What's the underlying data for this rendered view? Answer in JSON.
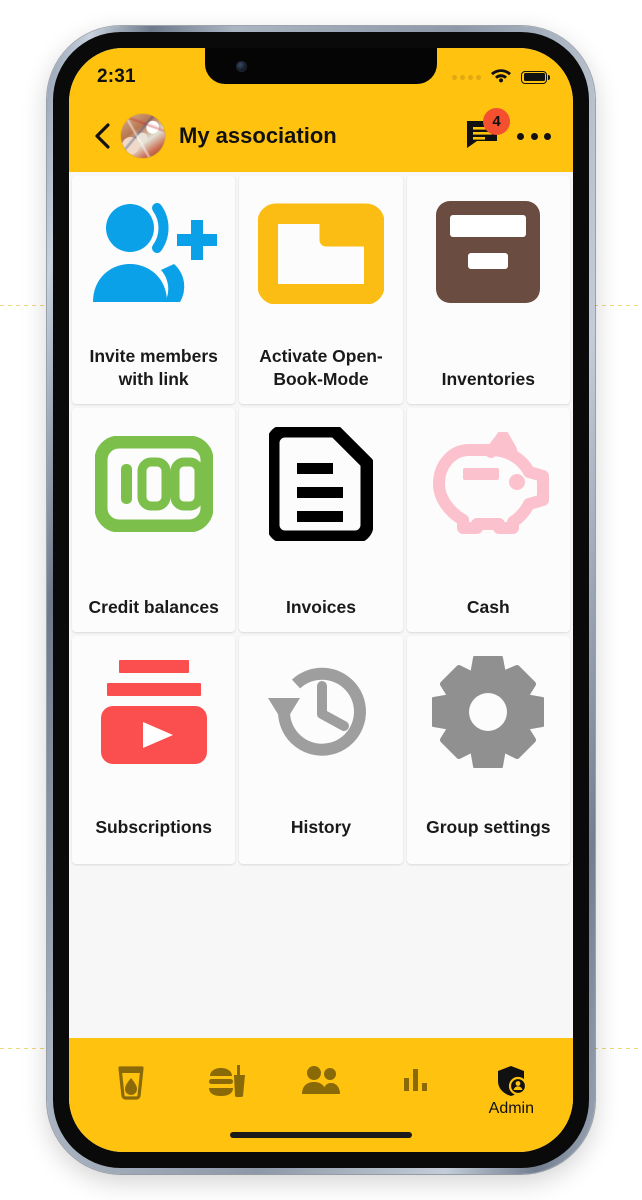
{
  "status_bar": {
    "time": "2:31",
    "cellular_icon": "signal-dots-icon",
    "wifi_icon": "wifi-icon",
    "battery_icon": "battery-full-icon"
  },
  "app_bar": {
    "back_icon": "back-chevron-icon",
    "avatar": "group-photo-avatar",
    "title": "My association",
    "chat_icon": "chat-bubble-icon",
    "chat_badge_count": "4",
    "overflow_icon": "more-options-icon"
  },
  "grid": {
    "tiles": [
      {
        "label": "Invite members with link",
        "icon": "person-add-icon",
        "color": "#0BA1E8"
      },
      {
        "label": "Activate Open-Book-Mode",
        "icon": "open-folder-icon",
        "color": "#FBBC13"
      },
      {
        "label": "Inventories",
        "icon": "archive-box-icon",
        "color": "#6B4C40"
      },
      {
        "label": "Credit balances",
        "icon": "banknote-100-icon",
        "color": "#7CBF4B"
      },
      {
        "label": "Invoices",
        "icon": "document-lines-icon",
        "color": "#000000"
      },
      {
        "label": "Cash",
        "icon": "piggy-bank-icon",
        "color": "#FBC2CD"
      },
      {
        "label": "Subscriptions",
        "icon": "subscriptions-play-icon",
        "color": "#FB4E4E"
      },
      {
        "label": "History",
        "icon": "clock-rotate-left-icon",
        "color": "#9E9E9E"
      },
      {
        "label": "Group settings",
        "icon": "gear-icon",
        "color": "#909090"
      }
    ]
  },
  "bottom_nav": {
    "items": [
      {
        "label": "",
        "icon": "drink-glass-icon"
      },
      {
        "label": "",
        "icon": "food-burger-drink-icon"
      },
      {
        "label": "",
        "icon": "people-group-icon"
      },
      {
        "label": "",
        "icon": "bar-chart-icon"
      },
      {
        "label": "Admin",
        "icon": "shield-person-icon"
      }
    ]
  },
  "colors": {
    "brand_yellow": "#FFC20E",
    "page_background": "#F7F7F7",
    "tile_background": "#FCFCFC",
    "badge_red": "#F4502F",
    "text_primary": "#111111"
  }
}
